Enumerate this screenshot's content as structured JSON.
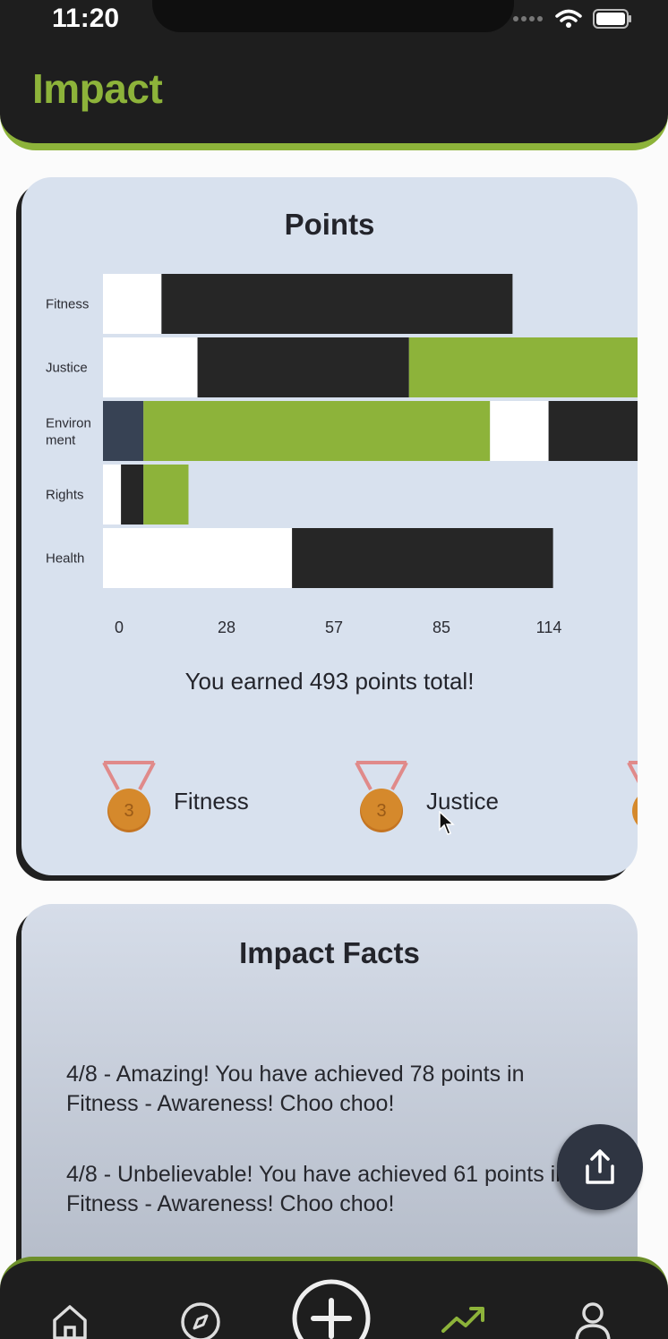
{
  "status_bar": {
    "time": "11:20"
  },
  "header": {
    "title": "Impact"
  },
  "points_card": {
    "title": "Points",
    "total_text": "You earned 493 points total!",
    "medals": [
      {
        "label": "Fitness",
        "rank": "3"
      },
      {
        "label": "Justice",
        "rank": "3"
      }
    ]
  },
  "chart_data": {
    "type": "bar",
    "orientation": "horizontal",
    "stacked": true,
    "categories": [
      "Fitness",
      "Justice",
      "Environ ment",
      "Rights",
      "Health"
    ],
    "x_ticks": [
      "0",
      "28",
      "57",
      "85",
      "114"
    ],
    "xlim": [
      0,
      114
    ],
    "segments": [
      [
        {
          "color": "#ffffff",
          "value": 13
        },
        {
          "color": "#262626",
          "value": 78
        }
      ],
      [
        {
          "color": "#ffffff",
          "value": 21
        },
        {
          "color": "#262626",
          "value": 47
        },
        {
          "color": "#8db33a",
          "value": 57
        }
      ],
      [
        {
          "color": "#374254",
          "value": 9
        },
        {
          "color": "#8db33a",
          "value": 77
        },
        {
          "color": "#ffffff",
          "value": 13
        },
        {
          "color": "#262626",
          "value": 36
        }
      ],
      [
        {
          "color": "#ffffff",
          "value": 4
        },
        {
          "color": "#262626",
          "value": 5
        },
        {
          "color": "#8db33a",
          "value": 10
        }
      ],
      [
        {
          "color": "#ffffff",
          "value": 42
        },
        {
          "color": "#262626",
          "value": 58
        }
      ]
    ]
  },
  "facts_card": {
    "title": "Impact Facts",
    "facts": [
      "4/8 - Amazing! You have achieved 78 points in Fitness - Awareness! Choo choo!",
      "4/8 - Unbelievable! You have achieved 61 points in Fitness - Awareness! Choo choo!"
    ]
  },
  "bottom_nav": {
    "items": [
      "home-icon",
      "compass-icon",
      "add-icon",
      "trending-icon",
      "profile-icon"
    ],
    "active": "trending-icon"
  },
  "colors": {
    "accent": "#8db33a",
    "dark": "#1e1e1e",
    "card": "#d8e1ee"
  }
}
